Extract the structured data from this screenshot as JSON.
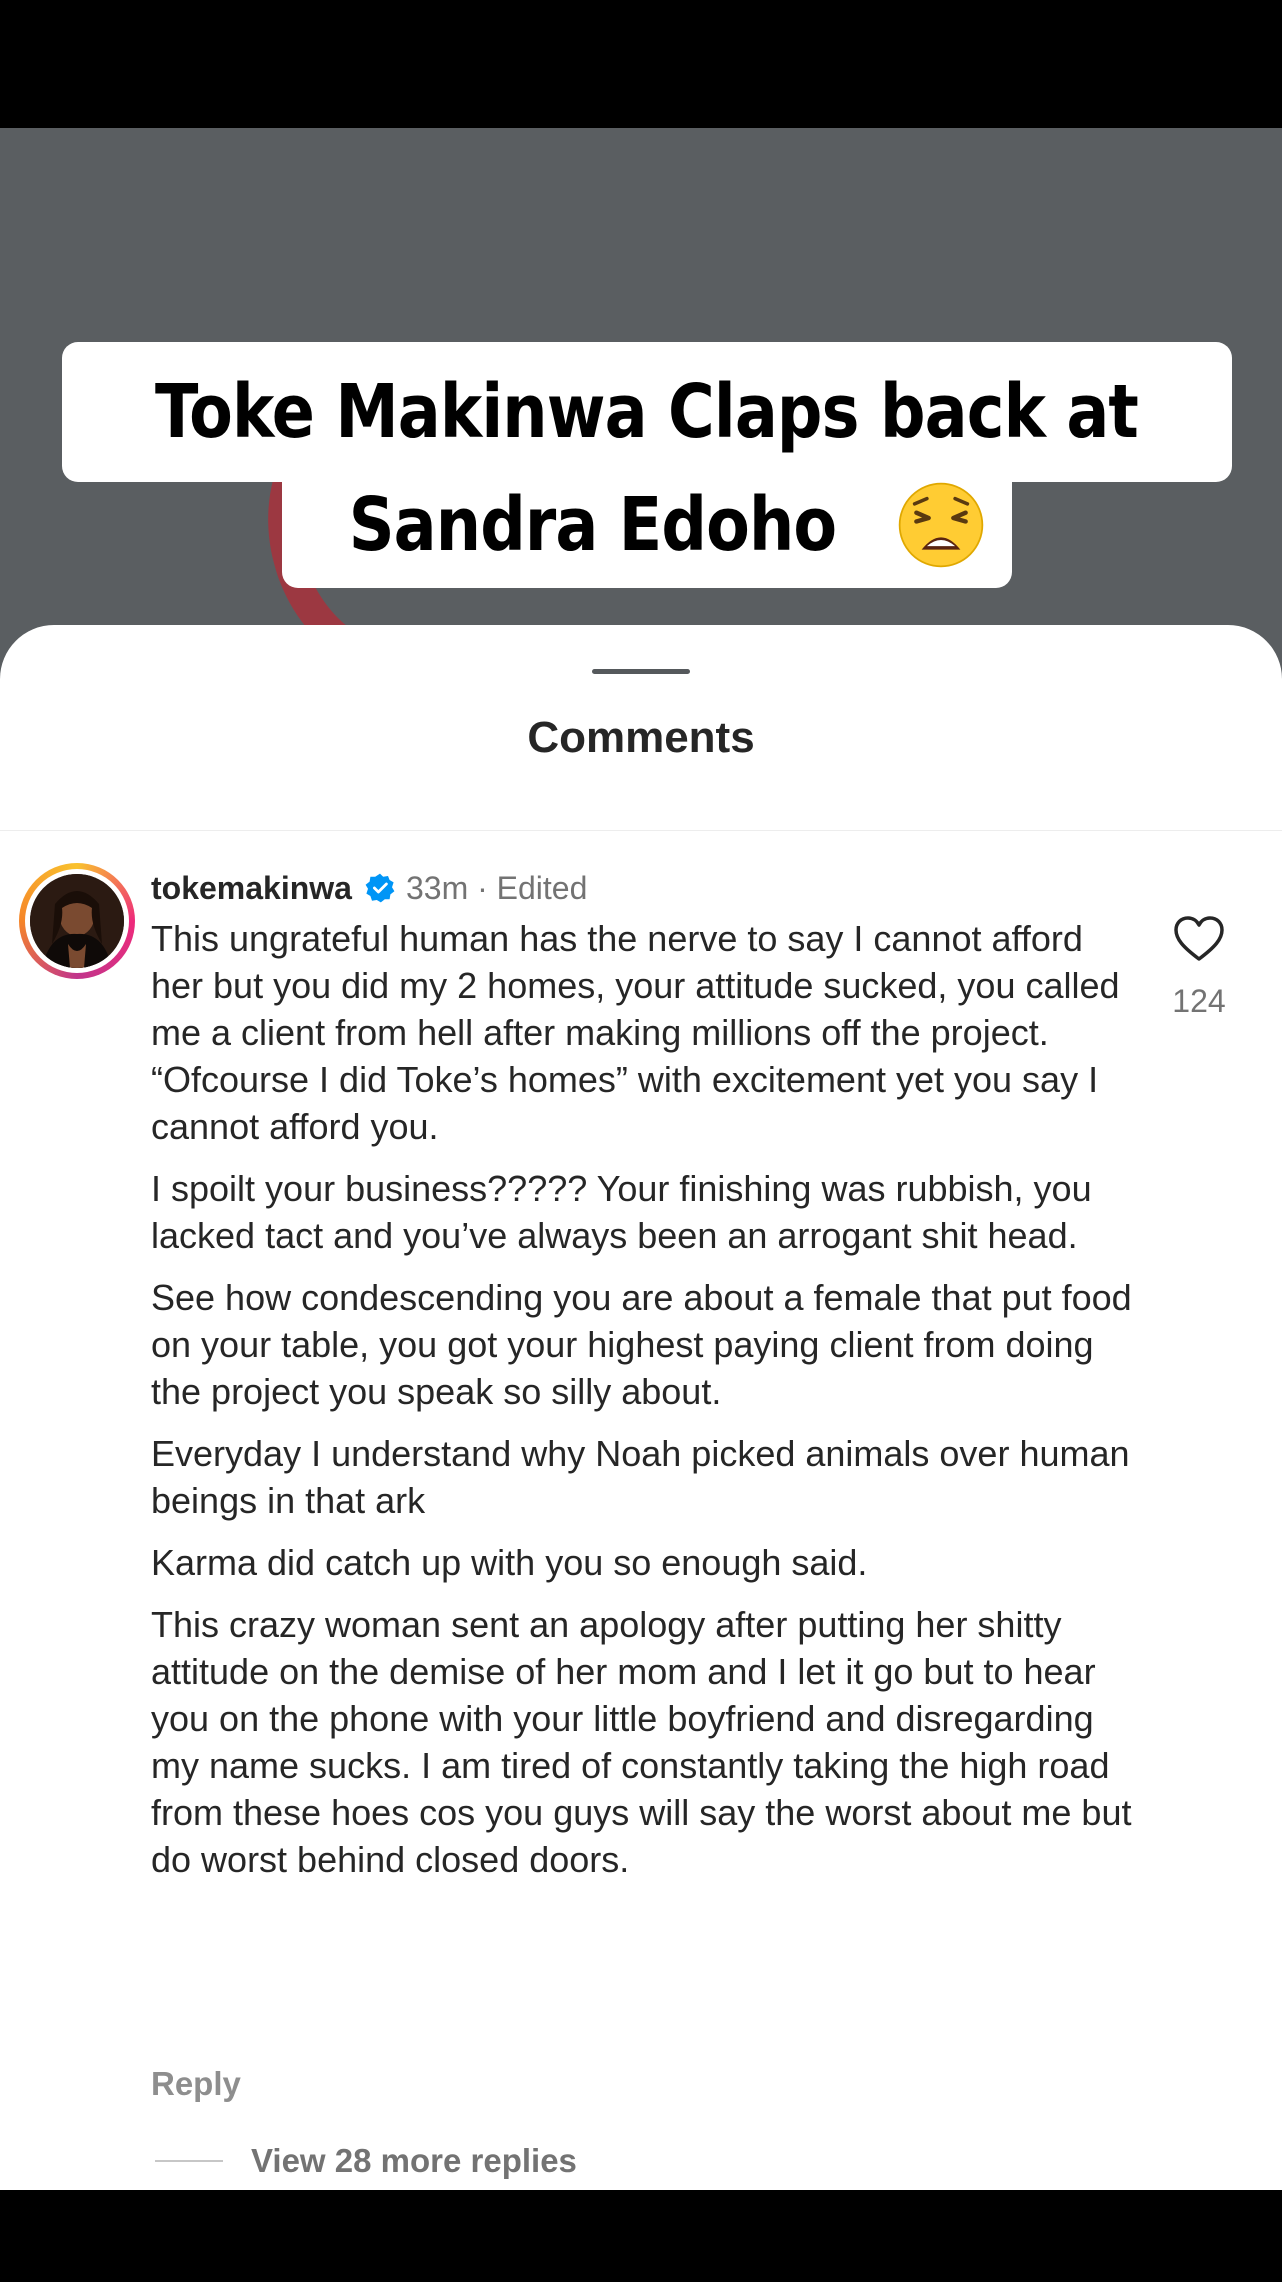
{
  "headline": {
    "line1": "Toke Makinwa Claps back at",
    "line2": "Sandra Edoho",
    "emoji": "weary-face-emoji"
  },
  "sheet": {
    "title": "Comments"
  },
  "comment": {
    "username": "tokemakinwa",
    "verified_icon": "verified-badge-icon",
    "meta": "33m · Edited",
    "paragraphs": [
      "This ungrateful human has the nerve to say I cannot afford her but you did my 2 homes, your attitude sucked, you called me a client from hell after making millions off the project. “Ofcourse I did Toke’s homes” with excitement yet you say I cannot afford you.",
      "I spoilt your business????? Your finishing was rubbish, you lacked tact and you’ve always been an arrogant shit head.",
      "See how condescending you are about a female that put food on your table, you got your highest paying client from doing the project you speak so silly about.",
      "Everyday I understand why Noah picked animals over human beings in that ark",
      "Karma did catch up with you so enough said.",
      "This crazy woman sent an apology after putting her shitty attitude on the demise of her mom and I let it go but to hear you on the phone with your little boyfriend and disregarding my name sucks. I am tired of constantly taking the high road from these hoes cos you guys will say the worst about me but do worst behind closed doors."
    ],
    "like_icon": "heart-outline-icon",
    "like_count": "124",
    "reply_label": "Reply",
    "view_replies_label": "View 28 more replies"
  },
  "colors": {
    "background_gray": "#5a5e61",
    "verified_blue": "#0095f6",
    "text_primary": "#262626",
    "text_secondary": "#737373"
  }
}
